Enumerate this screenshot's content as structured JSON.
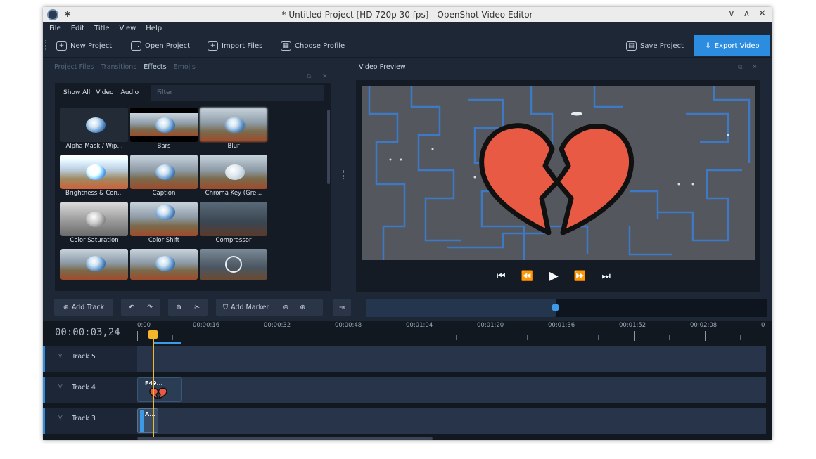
{
  "window": {
    "title": "* Untitled Project [HD 720p 30 fps] - OpenShot Video Editor",
    "controls": [
      "∨",
      "∧",
      "✕"
    ]
  },
  "menu": [
    "File",
    "Edit",
    "Title",
    "View",
    "Help"
  ],
  "toolbar": {
    "new_project": "New Project",
    "open_project": "Open Project",
    "import_files": "Import Files",
    "choose_profile": "Choose Profile",
    "save_project": "Save Project",
    "export_video": "Export Video"
  },
  "left_panel": {
    "tabs": [
      "Project Files",
      "Transitions",
      "Effects",
      "Emojis"
    ],
    "active_tab": "Effects",
    "filters": [
      "Show All",
      "Video",
      "Audio"
    ],
    "filter_placeholder": "Filter",
    "effects": [
      {
        "label": "Alpha Mask / Wip..."
      },
      {
        "label": "Bars"
      },
      {
        "label": "Blur"
      },
      {
        "label": "Brightness & Con..."
      },
      {
        "label": "Caption"
      },
      {
        "label": "Chroma Key (Gre..."
      },
      {
        "label": "Color Saturation"
      },
      {
        "label": "Color Shift"
      },
      {
        "label": "Compressor"
      },
      {
        "label": ""
      },
      {
        "label": ""
      },
      {
        "label": ""
      }
    ]
  },
  "preview": {
    "title": "Video Preview",
    "transport": [
      "⏮",
      "⏪",
      "▶",
      "⏩",
      "⏭"
    ]
  },
  "timeline": {
    "add_track": "Add Track",
    "add_marker": "Add Marker",
    "timecode": "00:00:03,24",
    "ticks": [
      "0:00",
      "00:00:16",
      "00:00:32",
      "00:00:48",
      "00:01:04",
      "00:01:20",
      "00:01:36",
      "00:01:52",
      "00:02:08",
      "0"
    ],
    "tracks": [
      {
        "name": "Track 5",
        "clip": ""
      },
      {
        "name": "Track 4",
        "clip": "F49..."
      },
      {
        "name": "Track 3",
        "clip": "A..."
      }
    ]
  },
  "colors": {
    "accent": "#2c8de0",
    "playhead": "#f5b62a",
    "heart": "#e85a43"
  }
}
